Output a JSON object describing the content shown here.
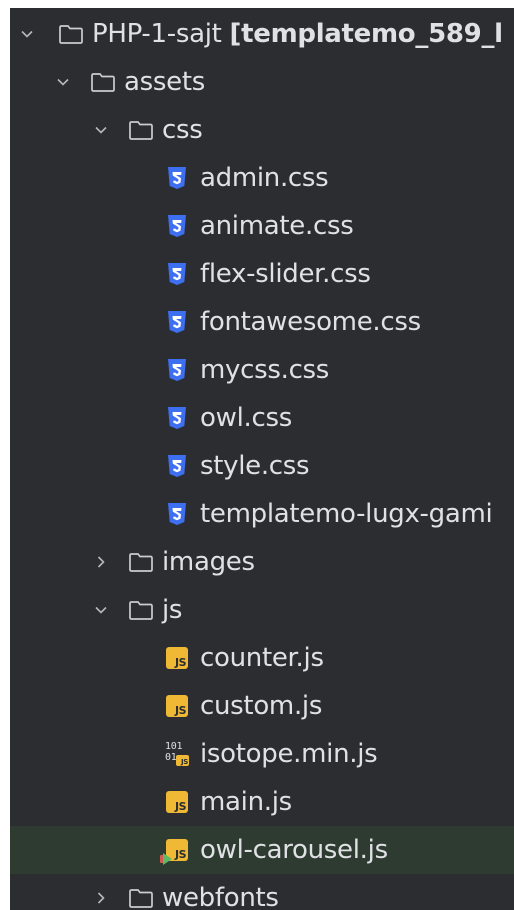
{
  "colors": {
    "panel_bg": "#2b2d30",
    "text": "#dfe1e5",
    "chevron": "#b4b8bf",
    "folder": "#c9cdd3",
    "css_icon": "#3d6ff0",
    "js_icon": "#f0b935",
    "highlight_row": "#2e3b30"
  },
  "tree": {
    "root": {
      "name": "PHP-1-sajt",
      "extra": "[templatemo_589_l",
      "expanded": true,
      "icon": "folder-icon"
    },
    "assets": {
      "name": "assets",
      "expanded": true,
      "icon": "folder-icon"
    },
    "css": {
      "name": "css",
      "expanded": true,
      "icon": "folder-icon"
    },
    "css_files": [
      {
        "name": "admin.css",
        "icon": "css-file-icon"
      },
      {
        "name": "animate.css",
        "icon": "css-file-icon"
      },
      {
        "name": "flex-slider.css",
        "icon": "css-file-icon"
      },
      {
        "name": "fontawesome.css",
        "icon": "css-file-icon"
      },
      {
        "name": "mycss.css",
        "icon": "css-file-icon"
      },
      {
        "name": "owl.css",
        "icon": "css-file-icon"
      },
      {
        "name": "style.css",
        "icon": "css-file-icon"
      },
      {
        "name": "templatemo-lugx-gami",
        "icon": "css-file-icon"
      }
    ],
    "images": {
      "name": "images",
      "expanded": false,
      "icon": "folder-icon"
    },
    "js": {
      "name": "js",
      "expanded": true,
      "icon": "folder-icon"
    },
    "js_files": [
      {
        "name": "counter.js",
        "icon": "js-file-icon",
        "badge": "JS"
      },
      {
        "name": "custom.js",
        "icon": "js-file-icon",
        "badge": "JS"
      },
      {
        "name": "isotope.min.js",
        "icon": "minified-js-file-icon",
        "badge": "JS",
        "binary": "101\n01"
      },
      {
        "name": "main.js",
        "icon": "js-file-icon",
        "badge": "JS"
      },
      {
        "name": "owl-carousel.js",
        "icon": "js-run-config-file-icon",
        "badge": "JS",
        "selected": true
      }
    ],
    "webfonts": {
      "name": "webfonts",
      "expanded": false,
      "icon": "folder-icon"
    }
  }
}
